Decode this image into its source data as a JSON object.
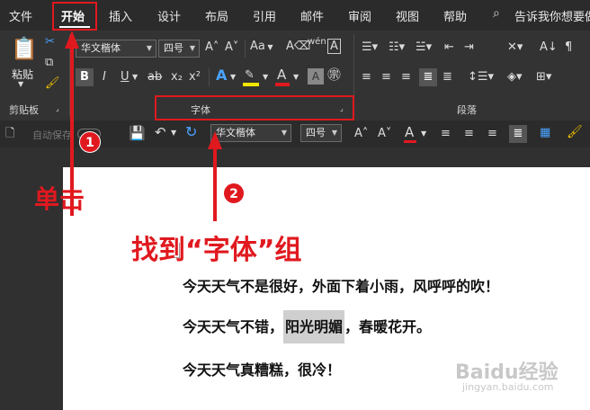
{
  "menu": [
    "文件",
    "开始",
    "插入",
    "设计",
    "布局",
    "引用",
    "邮件",
    "审阅",
    "视图",
    "帮助"
  ],
  "tell_me": "告诉我你想要做",
  "ribbon": {
    "paste_label": "粘贴",
    "font_name": "华文楷体",
    "font_size": "四号",
    "case_label": "Aa",
    "group_clipboard": "剪贴板",
    "group_font": "字体",
    "group_paragraph": "段落",
    "colors": {
      "highlight": "#f2e600",
      "font_color": "#e0191f"
    }
  },
  "qat": {
    "autosave": "自动保存",
    "font_name": "华文楷体",
    "font_size": "四号"
  },
  "document": {
    "line1": "今天天气不是很好，外面下着小雨，风呼呼的吹！",
    "line2_before": "今天天气不错，",
    "line2_highlight": "阳光明媚",
    "line2_after": "，春暖花开。",
    "line3": "今天天气真糟糕，很冷！"
  },
  "annotations": {
    "step1_number": "1",
    "step1_text": "单击",
    "step2_number": "2",
    "step2_text": "找到“字体”组",
    "accent": "#e0191f"
  },
  "watermark": {
    "brand": "Baidu经验",
    "url": "jingyan.baidu.com"
  }
}
